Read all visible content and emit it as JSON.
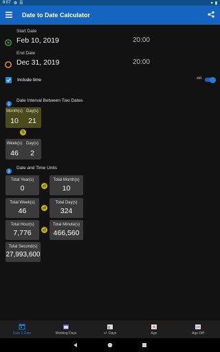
{
  "status_bar": {
    "time": "8:07"
  },
  "app_bar": {
    "title": "Date to Date Calculator"
  },
  "start": {
    "label": "Start Date",
    "date": "Feb 10, 2019",
    "time": "20:00"
  },
  "end": {
    "label": "End Date",
    "date": "Dec 31, 2019",
    "time": "20:00"
  },
  "include_time": {
    "label": "Include time",
    "toggle_label": "std."
  },
  "interval": {
    "title": "Date Interval Between Two Dates",
    "months_label": "Month(s)",
    "months_value": "10",
    "days_label": "Day(s)",
    "days_value": "21",
    "weeks_label": "Week(s)",
    "weeks_value": "46",
    "days2_label": "Day(s)",
    "days2_value": "2"
  },
  "units": {
    "title": "Date and Time Units",
    "total_years_label": "Total Year(s)",
    "total_years": "0",
    "total_months_label": "Total Month(s)",
    "total_months": "10",
    "total_weeks_label": "Total Week(s)",
    "total_weeks": "46",
    "total_days_label": "Total Day(s)",
    "total_days": "324",
    "total_hours_label": "Total Hour(s)",
    "total_hours": "7,776",
    "total_minutes_label": "Total Minute(s)",
    "total_minutes": "466,560",
    "total_seconds_label": "Total Second(s)",
    "total_seconds": "27,993,600"
  },
  "bottom_nav": [
    {
      "label": "Date 2 Date"
    },
    {
      "label": "Working Days"
    },
    {
      "label": "+/- Days"
    },
    {
      "label": "Age"
    },
    {
      "label": "Age Diff"
    }
  ],
  "colors": {
    "appbar": "#1565c0",
    "accent": "#2a79d1",
    "olive": "#4a4a1c"
  }
}
